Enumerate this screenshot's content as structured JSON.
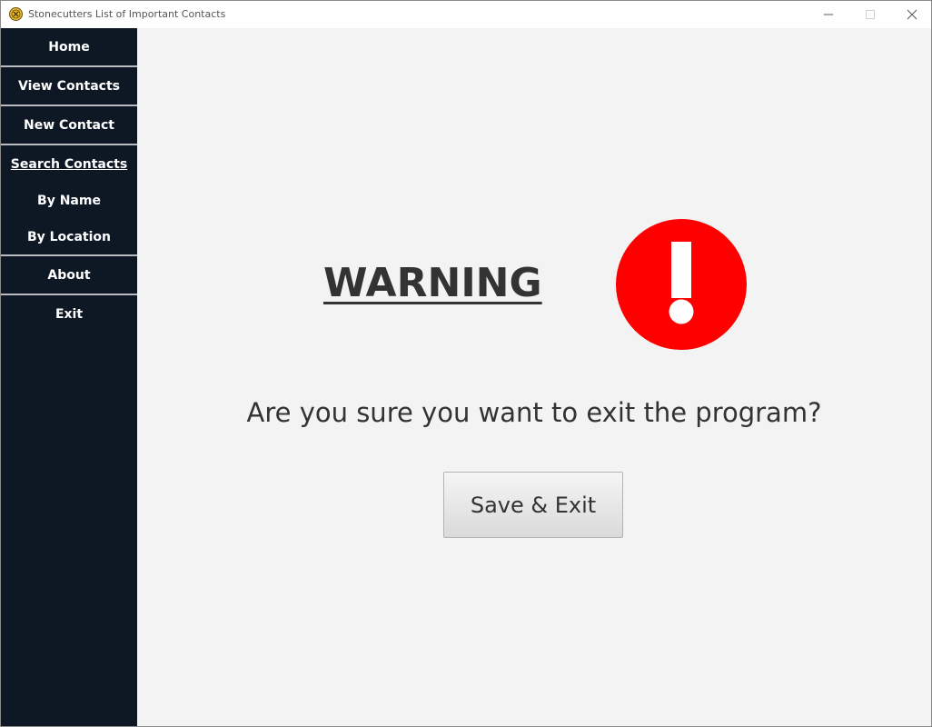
{
  "window": {
    "title": "Stonecutters List of Important Contacts",
    "app_icon": "stonecutters-emblem-icon",
    "controls": [
      "minimize-icon",
      "maximize-icon",
      "close-icon"
    ]
  },
  "sidebar": {
    "items": [
      {
        "label": "Home"
      },
      {
        "label": "View Contacts"
      },
      {
        "label": "New Contact"
      },
      {
        "label": "Search Contacts"
      },
      {
        "label": "By Name"
      },
      {
        "label": "By Location"
      },
      {
        "label": "About"
      },
      {
        "label": "Exit"
      }
    ]
  },
  "main": {
    "warning_title": "WARNING",
    "alert_icon": "exclamation-circle-icon",
    "question": "Are you sure you want to exit the program?",
    "save_exit_label": "Save & Exit"
  },
  "colors": {
    "sidebar_bg": "#0e1825",
    "main_bg": "#f3f3f3",
    "alert_red": "#ff0000",
    "text": "#333333"
  }
}
